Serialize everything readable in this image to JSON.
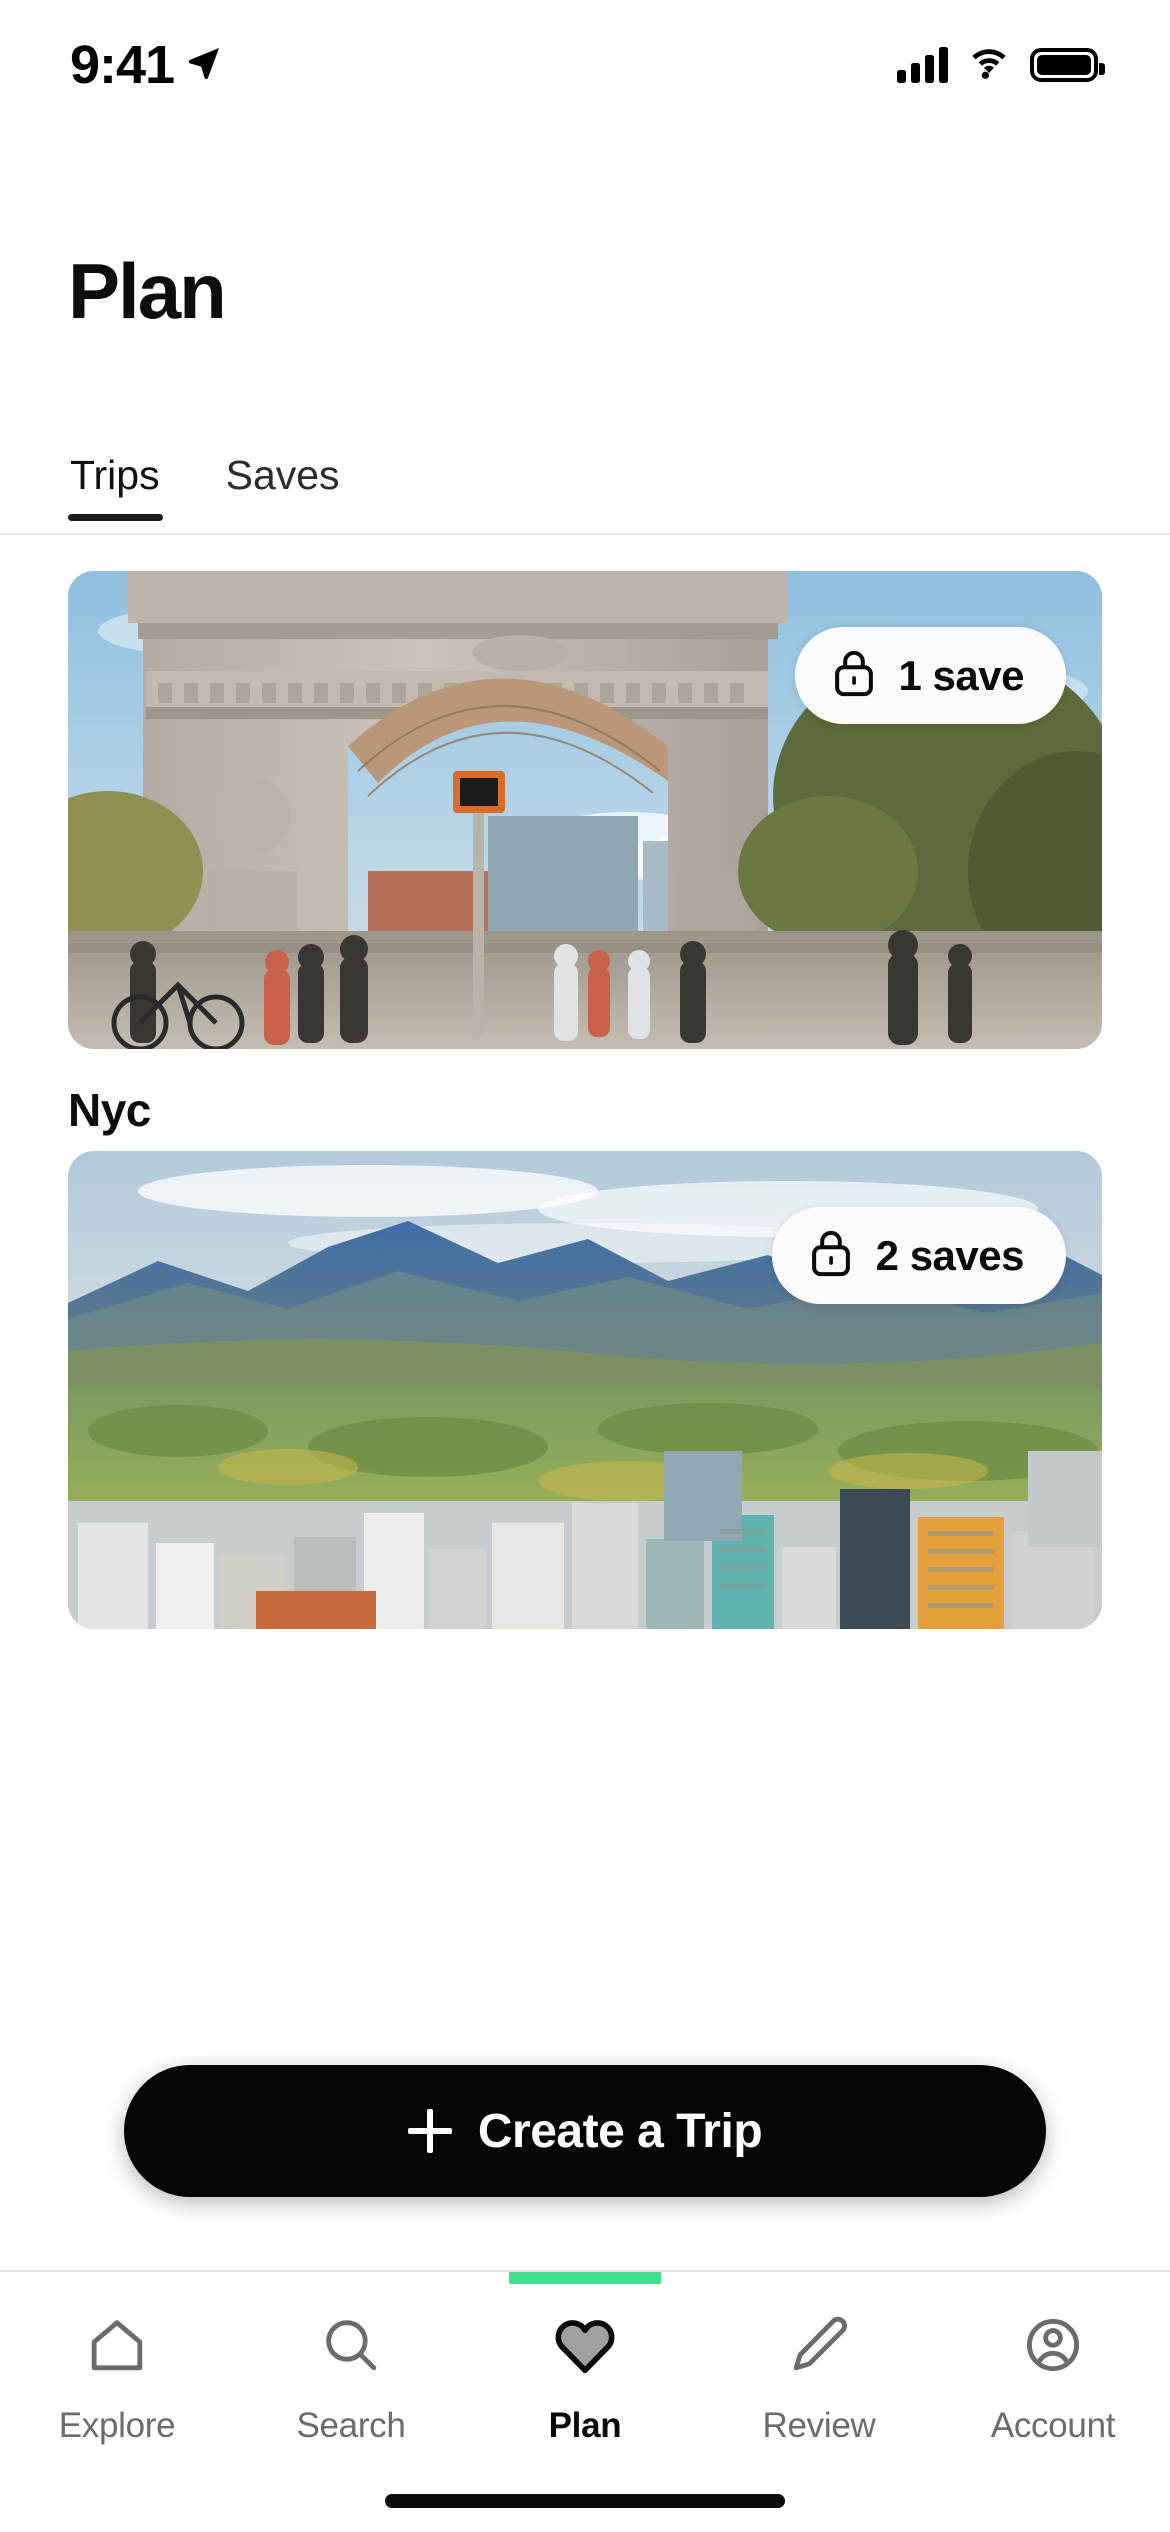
{
  "status_bar": {
    "time": "9:41",
    "location_icon": "location-arrow-icon",
    "signal_icon": "cellular-signal-icon",
    "wifi_icon": "wifi-icon",
    "battery_icon": "battery-full-icon"
  },
  "header": {
    "title": "Plan"
  },
  "tabs": [
    {
      "label": "Trips",
      "active": true
    },
    {
      "label": "Saves",
      "active": false
    }
  ],
  "trips": [
    {
      "title": "Nyc",
      "badge_label": "1 save",
      "badge_icon": "lock-icon",
      "image_alt": "Washington Square Arch, New York City"
    },
    {
      "title": "",
      "badge_label": "2 saves",
      "badge_icon": "lock-icon",
      "image_alt": "Salt Lake City skyline with mountains"
    }
  ],
  "create_trip_button": {
    "label": "Create a Trip",
    "icon": "plus-icon"
  },
  "bottom_nav": {
    "active_indicator_color": "#3ee08f",
    "items": [
      {
        "label": "Explore",
        "icon": "home-icon",
        "active": false
      },
      {
        "label": "Search",
        "icon": "search-icon",
        "active": false
      },
      {
        "label": "Plan",
        "icon": "heart-icon",
        "active": true
      },
      {
        "label": "Review",
        "icon": "pencil-icon",
        "active": false
      },
      {
        "label": "Account",
        "icon": "account-icon",
        "active": false
      }
    ]
  },
  "colors": {
    "accent_green": "#3ee08f",
    "text_primary": "#0d0d0d",
    "text_muted": "#6b6b6b",
    "button_black": "#050505"
  }
}
